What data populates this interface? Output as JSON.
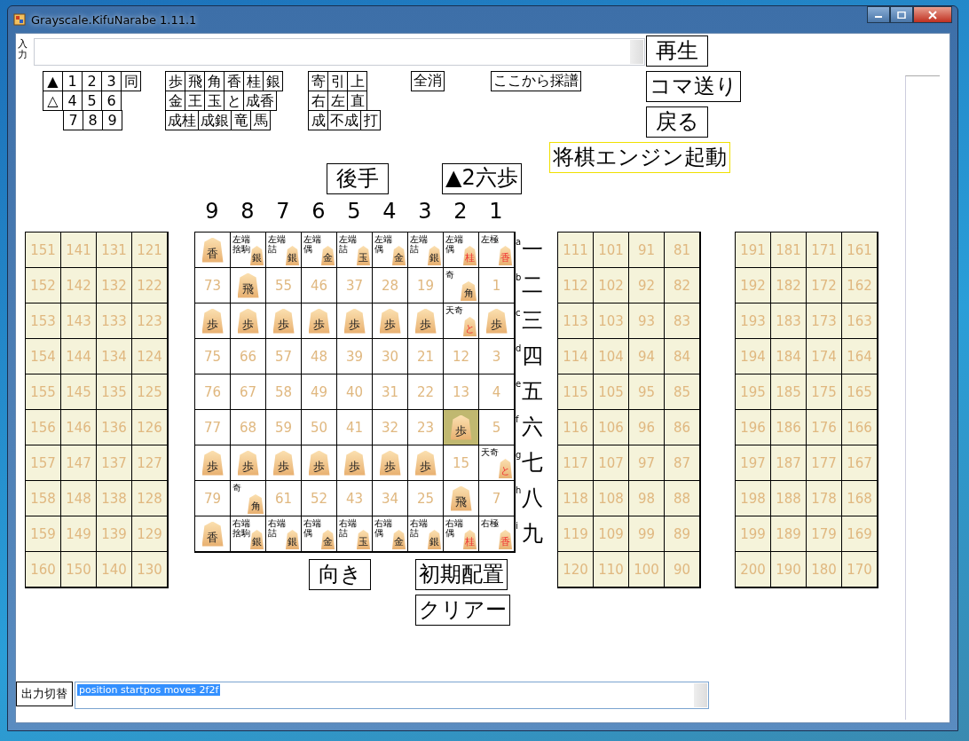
{
  "window": {
    "title": "Grayscale.KifuNarabe 1.11.1"
  },
  "input": {
    "label": "入力"
  },
  "keypads": [
    {
      "rows": [
        {
          "indented": false,
          "keys": [
            "▲",
            "1",
            "2",
            "3",
            "同"
          ]
        },
        {
          "indented": false,
          "keys": [
            "△",
            "4",
            "5",
            "6"
          ]
        },
        {
          "indented": true,
          "keys": [
            "7",
            "8",
            "9"
          ]
        }
      ]
    },
    {
      "rows": [
        {
          "indented": false,
          "keys": [
            "歩",
            "飛",
            "角",
            "香",
            "桂",
            "銀"
          ]
        },
        {
          "indented": false,
          "keys": [
            "金",
            "王",
            "玉",
            "と",
            "成香"
          ]
        },
        {
          "indented": false,
          "keys": [
            "成桂",
            "成銀",
            "竜",
            "馬"
          ]
        }
      ]
    },
    {
      "rows": [
        {
          "indented": false,
          "keys": [
            "寄",
            "引",
            "上"
          ]
        },
        {
          "indented": false,
          "keys": [
            "右",
            "左",
            "直"
          ]
        },
        {
          "indented": false,
          "keys": [
            "成",
            "不成",
            "打"
          ]
        }
      ]
    }
  ],
  "clear_all_button": "全消",
  "record_from_here_button": "ここから採譜",
  "playback_buttons": [
    "再生",
    "コマ送り",
    "戻る"
  ],
  "engine_button": "将棋エンジン起動",
  "gote_button": "後手",
  "last_move": "▲2六歩",
  "file_labels": [
    "9",
    "8",
    "7",
    "6",
    "5",
    "4",
    "3",
    "2",
    "1"
  ],
  "rank_labels": [
    {
      "letter": "a",
      "kanji": "一"
    },
    {
      "letter": "b",
      "kanji": "二"
    },
    {
      "letter": "c",
      "kanji": "三"
    },
    {
      "letter": "d",
      "kanji": "四"
    },
    {
      "letter": "e",
      "kanji": "五"
    },
    {
      "letter": "f",
      "kanji": "六"
    },
    {
      "letter": "g",
      "kanji": "七"
    },
    {
      "letter": "h",
      "kanji": "八"
    },
    {
      "letter": "i",
      "kanji": "九"
    }
  ],
  "board": [
    [
      {
        "kind": "piece",
        "piece": "香",
        "red": false,
        "selected": false
      },
      {
        "kind": "piece",
        "piece": "銀",
        "red": false,
        "notes": [
          "左端",
          "捨駒"
        ],
        "selected": false
      },
      {
        "kind": "piece",
        "piece": "銀",
        "red": false,
        "notes": [
          "左端",
          "詰"
        ],
        "selected": false
      },
      {
        "kind": "piece",
        "piece": "金",
        "red": false,
        "notes": [
          "左端",
          "偶"
        ],
        "selected": false
      },
      {
        "kind": "piece",
        "piece": "玉",
        "red": false,
        "notes": [
          "左端",
          "詰"
        ],
        "selected": false
      },
      {
        "kind": "piece",
        "piece": "金",
        "red": false,
        "notes": [
          "左端",
          "偶"
        ],
        "selected": false
      },
      {
        "kind": "piece",
        "piece": "銀",
        "red": false,
        "notes": [
          "左端",
          "詰"
        ],
        "selected": false
      },
      {
        "kind": "piece",
        "piece": "桂",
        "red": true,
        "notes": [
          "左端",
          "偶"
        ],
        "selected": false
      },
      {
        "kind": "piece",
        "piece": "香",
        "red": true,
        "notes": [
          "左極"
        ],
        "selected": false
      }
    ],
    [
      {
        "kind": "number",
        "number": "73",
        "selected": false
      },
      {
        "kind": "piece",
        "piece": "飛",
        "red": false,
        "selected": false
      },
      {
        "kind": "number",
        "number": "55",
        "selected": false
      },
      {
        "kind": "number",
        "number": "46",
        "selected": false
      },
      {
        "kind": "number",
        "number": "37",
        "selected": false
      },
      {
        "kind": "number",
        "number": "28",
        "selected": false
      },
      {
        "kind": "number",
        "number": "19",
        "selected": false
      },
      {
        "kind": "piece",
        "piece": "角",
        "red": false,
        "notes": [
          "奇"
        ],
        "selected": false
      },
      {
        "kind": "number",
        "number": "1",
        "selected": false
      }
    ],
    [
      {
        "kind": "piece",
        "piece": "歩",
        "red": false,
        "selected": false
      },
      {
        "kind": "piece",
        "piece": "歩",
        "red": false,
        "selected": false
      },
      {
        "kind": "piece",
        "piece": "歩",
        "red": false,
        "selected": false
      },
      {
        "kind": "piece",
        "piece": "歩",
        "red": false,
        "selected": false
      },
      {
        "kind": "piece",
        "piece": "歩",
        "red": false,
        "selected": false
      },
      {
        "kind": "piece",
        "piece": "歩",
        "red": false,
        "selected": false
      },
      {
        "kind": "piece",
        "piece": "歩",
        "red": false,
        "selected": false
      },
      {
        "kind": "piece",
        "piece": "と",
        "red": true,
        "notes": [
          "天奇"
        ],
        "selected": false
      },
      {
        "kind": "piece",
        "piece": "歩",
        "red": false,
        "selected": false
      }
    ],
    [
      {
        "kind": "number",
        "number": "75",
        "selected": false
      },
      {
        "kind": "number",
        "number": "66",
        "selected": false
      },
      {
        "kind": "number",
        "number": "57",
        "selected": false
      },
      {
        "kind": "number",
        "number": "48",
        "selected": false
      },
      {
        "kind": "number",
        "number": "39",
        "selected": false
      },
      {
        "kind": "number",
        "number": "30",
        "selected": false
      },
      {
        "kind": "number",
        "number": "21",
        "selected": false
      },
      {
        "kind": "number",
        "number": "12",
        "selected": false
      },
      {
        "kind": "number",
        "number": "3",
        "selected": false
      }
    ],
    [
      {
        "kind": "number",
        "number": "76",
        "selected": false
      },
      {
        "kind": "number",
        "number": "67",
        "selected": false
      },
      {
        "kind": "number",
        "number": "58",
        "selected": false
      },
      {
        "kind": "number",
        "number": "49",
        "selected": false
      },
      {
        "kind": "number",
        "number": "40",
        "selected": false
      },
      {
        "kind": "number",
        "number": "31",
        "selected": false
      },
      {
        "kind": "number",
        "number": "22",
        "selected": false
      },
      {
        "kind": "number",
        "number": "13",
        "selected": false
      },
      {
        "kind": "number",
        "number": "4",
        "selected": false
      }
    ],
    [
      {
        "kind": "number",
        "number": "77",
        "selected": false
      },
      {
        "kind": "number",
        "number": "68",
        "selected": false
      },
      {
        "kind": "number",
        "number": "59",
        "selected": false
      },
      {
        "kind": "number",
        "number": "50",
        "selected": false
      },
      {
        "kind": "number",
        "number": "41",
        "selected": false
      },
      {
        "kind": "number",
        "number": "32",
        "selected": false
      },
      {
        "kind": "number",
        "number": "23",
        "selected": false
      },
      {
        "kind": "piece",
        "piece": "歩",
        "red": false,
        "selected": true
      },
      {
        "kind": "number",
        "number": "5",
        "selected": false
      }
    ],
    [
      {
        "kind": "piece",
        "piece": "歩",
        "red": false,
        "selected": false
      },
      {
        "kind": "piece",
        "piece": "歩",
        "red": false,
        "selected": false
      },
      {
        "kind": "piece",
        "piece": "歩",
        "red": false,
        "selected": false
      },
      {
        "kind": "piece",
        "piece": "歩",
        "red": false,
        "selected": false
      },
      {
        "kind": "piece",
        "piece": "歩",
        "red": false,
        "selected": false
      },
      {
        "kind": "piece",
        "piece": "歩",
        "red": false,
        "selected": false
      },
      {
        "kind": "piece",
        "piece": "歩",
        "red": false,
        "selected": false
      },
      {
        "kind": "number",
        "number": "15",
        "selected": false
      },
      {
        "kind": "piece",
        "piece": "と",
        "red": true,
        "notes": [
          "天奇"
        ],
        "selected": false
      }
    ],
    [
      {
        "kind": "number",
        "number": "79",
        "selected": false
      },
      {
        "kind": "piece",
        "piece": "角",
        "red": false,
        "notes": [
          "奇"
        ],
        "selected": false
      },
      {
        "kind": "number",
        "number": "61",
        "selected": false
      },
      {
        "kind": "number",
        "number": "52",
        "selected": false
      },
      {
        "kind": "number",
        "number": "43",
        "selected": false
      },
      {
        "kind": "number",
        "number": "34",
        "selected": false
      },
      {
        "kind": "number",
        "number": "25",
        "selected": false
      },
      {
        "kind": "piece",
        "piece": "飛",
        "red": false,
        "selected": false
      },
      {
        "kind": "number",
        "number": "7",
        "selected": false
      }
    ],
    [
      {
        "kind": "piece",
        "piece": "香",
        "red": false,
        "selected": false
      },
      {
        "kind": "piece",
        "piece": "銀",
        "red": false,
        "notes": [
          "右端",
          "捨駒"
        ],
        "selected": false
      },
      {
        "kind": "piece",
        "piece": "銀",
        "red": false,
        "notes": [
          "右端",
          "詰"
        ],
        "selected": false
      },
      {
        "kind": "piece",
        "piece": "金",
        "red": false,
        "notes": [
          "右端",
          "偶"
        ],
        "selected": false
      },
      {
        "kind": "piece",
        "piece": "玉",
        "red": false,
        "notes": [
          "右端",
          "詰"
        ],
        "selected": false
      },
      {
        "kind": "piece",
        "piece": "金",
        "red": false,
        "notes": [
          "右端",
          "偶"
        ],
        "selected": false
      },
      {
        "kind": "piece",
        "piece": "銀",
        "red": false,
        "notes": [
          "右端",
          "詰"
        ],
        "selected": false
      },
      {
        "kind": "piece",
        "piece": "桂",
        "red": true,
        "notes": [
          "右端",
          "偶"
        ],
        "selected": false
      },
      {
        "kind": "piece",
        "piece": "香",
        "red": true,
        "notes": [
          "右極"
        ],
        "selected": false
      }
    ]
  ],
  "stands": [
    [
      [
        "151",
        "141",
        "131",
        "121"
      ],
      [
        "152",
        "142",
        "132",
        "122"
      ],
      [
        "153",
        "143",
        "133",
        "123"
      ],
      [
        "154",
        "144",
        "134",
        "124"
      ],
      [
        "155",
        "145",
        "135",
        "125"
      ],
      [
        "156",
        "146",
        "136",
        "126"
      ],
      [
        "157",
        "147",
        "137",
        "127"
      ],
      [
        "158",
        "148",
        "138",
        "128"
      ],
      [
        "159",
        "149",
        "139",
        "129"
      ],
      [
        "160",
        "150",
        "140",
        "130"
      ]
    ],
    [
      [
        "111",
        "101",
        "91",
        "81"
      ],
      [
        "112",
        "102",
        "92",
        "82"
      ],
      [
        "113",
        "103",
        "93",
        "83"
      ],
      [
        "114",
        "104",
        "94",
        "84"
      ],
      [
        "115",
        "105",
        "95",
        "85"
      ],
      [
        "116",
        "106",
        "96",
        "86"
      ],
      [
        "117",
        "107",
        "97",
        "87"
      ],
      [
        "118",
        "108",
        "98",
        "88"
      ],
      [
        "119",
        "109",
        "99",
        "89"
      ],
      [
        "120",
        "110",
        "100",
        "90"
      ]
    ],
    [
      [
        "191",
        "181",
        "171",
        "161"
      ],
      [
        "192",
        "182",
        "172",
        "162"
      ],
      [
        "193",
        "183",
        "173",
        "163"
      ],
      [
        "194",
        "184",
        "174",
        "164"
      ],
      [
        "195",
        "185",
        "175",
        "165"
      ],
      [
        "196",
        "186",
        "176",
        "166"
      ],
      [
        "197",
        "187",
        "177",
        "167"
      ],
      [
        "198",
        "188",
        "178",
        "168"
      ],
      [
        "199",
        "189",
        "179",
        "169"
      ],
      [
        "200",
        "190",
        "180",
        "170"
      ]
    ]
  ],
  "orientation_button": "向き",
  "initial_setup_button": "初期配置",
  "clear_button": "クリアー",
  "output_toggle_button": "出力切替",
  "output": {
    "value": "position startpos moves 2f2f",
    "selected": true
  }
}
